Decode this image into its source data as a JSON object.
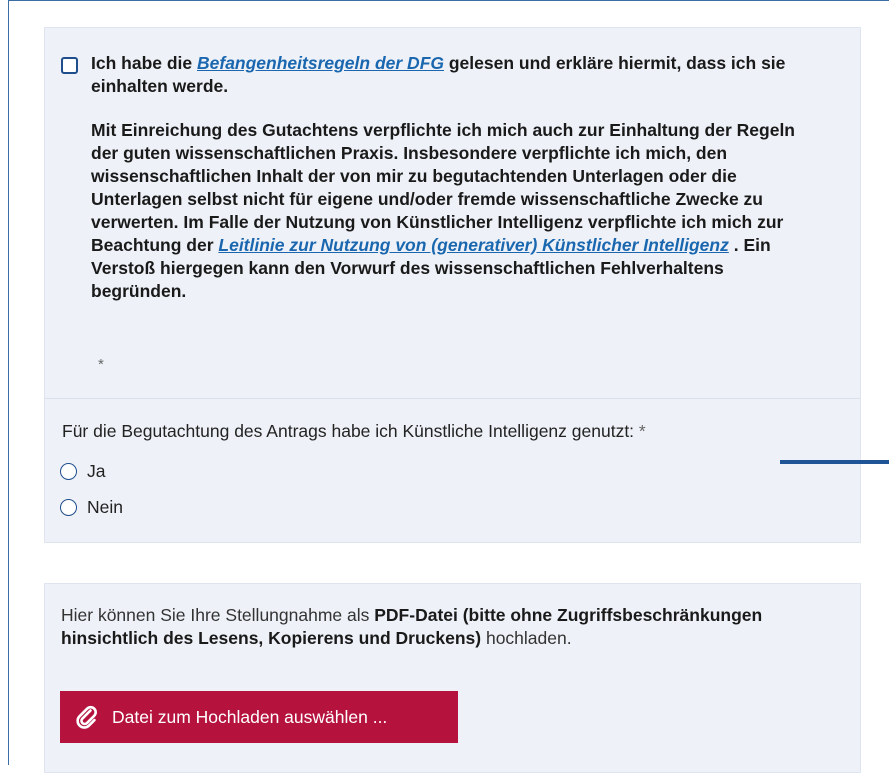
{
  "consent": {
    "line1_before": "Ich habe die ",
    "link1": "Befangenheitsregeln der DFG",
    "line1_after": " gelesen und erkläre hiermit, dass ich sie einhalten werde.",
    "para2_main": "Mit Einreichung des Gutachtens verpflichte ich mich auch zur Einhaltung der Regeln der guten wissenschaftlichen Praxis. Insbesondere verpflichte ich mich, den wissenschaftlichen Inhalt der von mir zu begutachtenden Unterlagen oder die Unterlagen selbst nicht für eigene und/oder fremde wissenschaftliche Zwecke zu verwerten. Im Falle der Nutzung von Künstlicher Intelligenz verpflichte ich mich zur Beachtung der ",
    "link2": "Leitlinie zur Nutzung von (generativer) Künstlicher Intelligenz",
    "para2_after": " . Ein Verstoß hiergegen kann den Vorwurf des wissenschaftlichen Fehlverhaltens begründen.",
    "required_mark": "*"
  },
  "ai_question": {
    "label": "Für die Begutachtung des Antrags habe ich Künstliche Intelligenz genutzt:",
    "required_mark": "*",
    "options": [
      "Ja",
      "Nein"
    ]
  },
  "upload": {
    "text_intro": "Hier können Sie Ihre Stellungnahme als ",
    "text_bold": "PDF-Datei (bitte ohne Zugriffsbeschränkungen hinsichtlich des Lesens, Kopierens und Druckens)",
    "text_outro": " hochladen.",
    "button_label": "Datei zum Hochladen auswählen ...",
    "button_icon": "paperclip-icon"
  },
  "colors": {
    "accent_blue": "#1f5597",
    "link_blue": "#1a67b0",
    "button_red": "#b5123e",
    "panel_bg": "#eef2f8"
  }
}
